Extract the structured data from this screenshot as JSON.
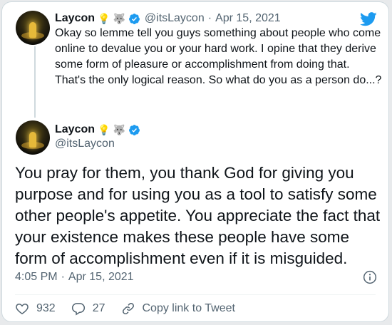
{
  "tweet1": {
    "name": "Laycon",
    "emojis": [
      "💡",
      "🐺"
    ],
    "handle": "@itsLaycon",
    "separator": "·",
    "date": "Apr 15, 2021",
    "text": "Okay so lemme tell you guys something about people who come online to devalue you or your hard work. I opine that they derive some form of pleasure or accomplishment from doing that. That's the only logical reason. So what do you as a person do...?"
  },
  "tweet2": {
    "name": "Laycon",
    "emojis": [
      "💡",
      "🐺"
    ],
    "handle": "@itsLaycon",
    "text": "You pray for them, you thank God for giving you purpose and for using you as a tool to satisfy some other people's appetite. You appreciate the fact that your existence makes these people have some form of accomplishment even if it is misguided.",
    "time": "4:05 PM",
    "separator": "·",
    "date": "Apr 15, 2021"
  },
  "actions": {
    "likes": "932",
    "replies": "27",
    "copy_link": "Copy link to Tweet"
  },
  "colors": {
    "brand": "#1d9bf0",
    "text": "#0f1419",
    "muted": "#536471"
  },
  "icons": [
    "twitter-bird-icon",
    "verified-badge-icon",
    "info-icon",
    "heart-icon",
    "reply-icon",
    "link-icon"
  ]
}
